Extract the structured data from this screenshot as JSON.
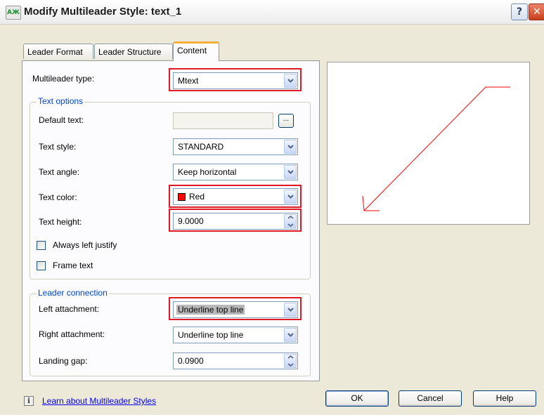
{
  "window": {
    "title": "Modify Multileader Style: text_1",
    "icon_text": "AЖ",
    "help_glyph": "?",
    "close_glyph": "✕"
  },
  "tabs": [
    {
      "label": "Leader Format",
      "active": false
    },
    {
      "label": "Leader Structure",
      "active": false
    },
    {
      "label": "Content",
      "active": true
    }
  ],
  "content": {
    "multileader_type": {
      "label": "Multileader type:",
      "value": "Mtext",
      "highlighted": true
    },
    "text_options": {
      "legend": "Text options",
      "default_text": {
        "label": "Default text:",
        "value": "",
        "button_label": "..."
      },
      "text_style": {
        "label": "Text style:",
        "value": "STANDARD"
      },
      "text_angle": {
        "label": "Text angle:",
        "value": "Keep horizontal"
      },
      "text_color": {
        "label": "Text color:",
        "value": "Red",
        "swatch": "#ff0000",
        "highlighted": true
      },
      "text_height": {
        "label": "Text height:",
        "value": "9.0000",
        "highlighted": true
      },
      "always_left_justify": {
        "label": "Always left justify",
        "checked": false
      },
      "frame_text": {
        "label": "Frame text",
        "checked": false
      }
    },
    "leader_connection": {
      "legend": "Leader connection",
      "left_attachment": {
        "label": "Left attachment:",
        "value": "Underline top line",
        "highlighted": true
      },
      "right_attachment": {
        "label": "Right attachment:",
        "value": "Underline top line"
      },
      "landing_gap": {
        "label": "Landing gap:",
        "value": "0.0900"
      }
    }
  },
  "preview": {
    "leader_color": "#ff0000"
  },
  "footer": {
    "info_glyph": "i",
    "learn_link": "Learn about Multileader Styles",
    "ok": "OK",
    "cancel": "Cancel",
    "help": "Help"
  },
  "colors": {
    "highlight": "#e01a25",
    "group_legend": "#0046d5",
    "dialog_bg": "#ece9d8"
  }
}
